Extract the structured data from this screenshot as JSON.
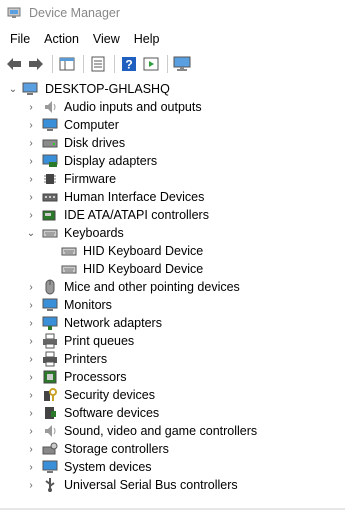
{
  "window": {
    "title": "Device Manager"
  },
  "menu": [
    "File",
    "Action",
    "View",
    "Help"
  ],
  "toolbar": {
    "buttons": [
      "back",
      "forward",
      "properties",
      "update-driver",
      "help",
      "run",
      "scan-hardware"
    ]
  },
  "tree": {
    "root": "DESKTOP-GHLASHQ",
    "categories": [
      "Audio inputs and outputs",
      "Computer",
      "Disk drives",
      "Display adapters",
      "Firmware",
      "Human Interface Devices",
      "IDE ATA/ATAPI controllers",
      "Keyboards",
      "Mice and other pointing devices",
      "Monitors",
      "Network adapters",
      "Print queues",
      "Printers",
      "Processors",
      "Security devices",
      "Software devices",
      "Sound, video and game controllers",
      "Storage controllers",
      "System devices",
      "Universal Serial Bus controllers"
    ],
    "keyboard_children": [
      "HID Keyboard Device",
      "HID Keyboard Device"
    ]
  }
}
